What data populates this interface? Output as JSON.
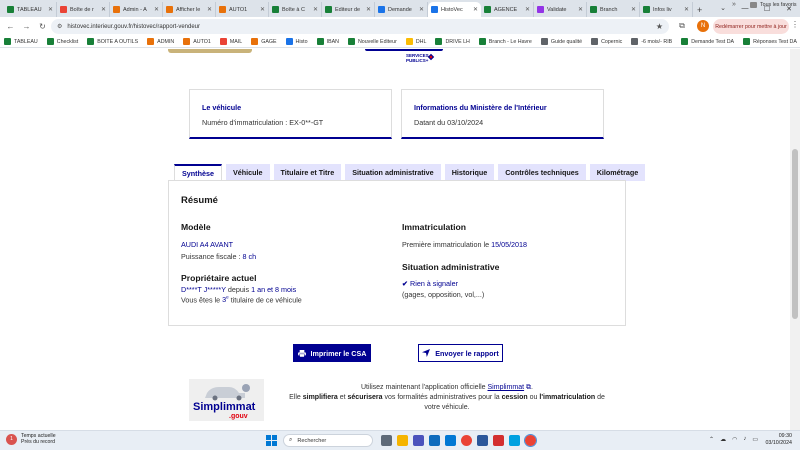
{
  "browser": {
    "tabs": [
      {
        "label": "TABLEAU",
        "color": "#188038"
      },
      {
        "label": "Boîte de r",
        "color": "#ea4335"
      },
      {
        "label": "Admin - A",
        "color": "#e8710a"
      },
      {
        "label": "Afficher le",
        "color": "#e8710a"
      },
      {
        "label": "AUTO1",
        "color": "#e8710a"
      },
      {
        "label": "Boîte à C",
        "color": "#188038"
      },
      {
        "label": "Éditeur de",
        "color": "#188038"
      },
      {
        "label": "Demande",
        "color": "#1a73e8"
      },
      {
        "label": "HistoVec",
        "color": "#1a73e8",
        "active": true
      },
      {
        "label": "AGENCE",
        "color": "#188038"
      },
      {
        "label": "Validate",
        "color": "#9334e6"
      },
      {
        "label": "Branch",
        "color": "#188038"
      },
      {
        "label": "Infos liv",
        "color": "#188038"
      }
    ],
    "url": "histovec.interieur.gouv.fr/histovec/rapport-vendeur",
    "restart_label": "Redémarrer pour mettre à jour",
    "profile_initial": "N",
    "bookmarks": [
      {
        "label": "TABLEAU",
        "color": "#188038"
      },
      {
        "label": "Checklist",
        "color": "#188038"
      },
      {
        "label": "BOITE A OUTILS",
        "color": "#188038"
      },
      {
        "label": "ADMIN",
        "color": "#e8710a"
      },
      {
        "label": "AUTO1",
        "color": "#e8710a"
      },
      {
        "label": "MAIL",
        "color": "#ea4335"
      },
      {
        "label": "GAGE",
        "color": "#e8710a"
      },
      {
        "label": "Histo",
        "color": "#1a73e8"
      },
      {
        "label": "IBAN",
        "color": "#188038"
      },
      {
        "label": "Nouvelle Editeur",
        "color": "#188038"
      },
      {
        "label": "DHL",
        "color": "#fbbc04"
      },
      {
        "label": "DRIVE LH",
        "color": "#188038"
      },
      {
        "label": "Branch - Le Havre",
        "color": "#188038"
      },
      {
        "label": "Guide qualité",
        "color": "#5f6368"
      },
      {
        "label": "Copernic",
        "color": "#5f6368"
      },
      {
        "label": "-6 mois/- RIB",
        "color": "#5f6368"
      },
      {
        "label": "Demande Test DA",
        "color": "#188038"
      },
      {
        "label": "Réponses Test DA",
        "color": "#188038"
      }
    ],
    "all_bookmarks_label": "Tous les favoris"
  },
  "page": {
    "gov_logo_text": [
      "SERVICES",
      "PUBLICS+"
    ],
    "card_vehicle": {
      "title": "Le véhicule",
      "text": "Numéro d'immatriculation : EX-0**-GT"
    },
    "card_ministry": {
      "title": "Informations du Ministère de l'Intérieur",
      "text": "Datant du 03/10/2024"
    },
    "tabs": [
      "Synthèse",
      "Véhicule",
      "Titulaire et Titre",
      "Situation administrative",
      "Historique",
      "Contrôles techniques",
      "Kilométrage"
    ],
    "resume": {
      "title": "Résumé",
      "model_heading": "Modèle",
      "model_value": "AUDI A4 AVANT",
      "fiscal_label": "Puissance fiscale :",
      "fiscal_value": "8 ch",
      "owner_heading": "Propriétaire actuel",
      "owner_name": "D****T J*****Y",
      "owner_since_label": "depuis",
      "owner_since_value": "1 an et 8 mois",
      "holder_prefix": "Vous êtes le",
      "holder_rank": "3",
      "holder_rank_sup": "e",
      "holder_suffix": "titulaire de ce véhicule",
      "immat_heading": "Immatriculation",
      "first_immat_label": "Première immatriculation le",
      "first_immat_value": "15/05/2018",
      "admin_heading": "Situation administrative",
      "admin_status": "Rien à signaler",
      "admin_detail": "(gages, opposition, vol,...)"
    },
    "btn_print": "Imprimer le CSA",
    "btn_send": "Envoyer le rapport",
    "simplimmat": {
      "logo_word": "Simplimmat",
      "logo_sub": ".gouv",
      "line1_prefix": "Utilisez maintenant l'application officielle",
      "link": "Simplimmat",
      "line2_a": "Elle",
      "line2_b": "simplifiera",
      "line2_c": "et",
      "line2_d": "sécurisera",
      "line2_e": "vos formalités administratives pour la",
      "line2_f": "cession",
      "line2_g": "ou",
      "line2_h": "l'immatriculation",
      "line2_i": "de",
      "line3": "votre véhicule."
    }
  },
  "taskbar": {
    "weather_temp": "1",
    "weather_title": "Temps actuelle",
    "weather_sub": "Près du record",
    "search_placeholder": "Rechercher",
    "time": "09:30",
    "date": "03/10/2024"
  }
}
